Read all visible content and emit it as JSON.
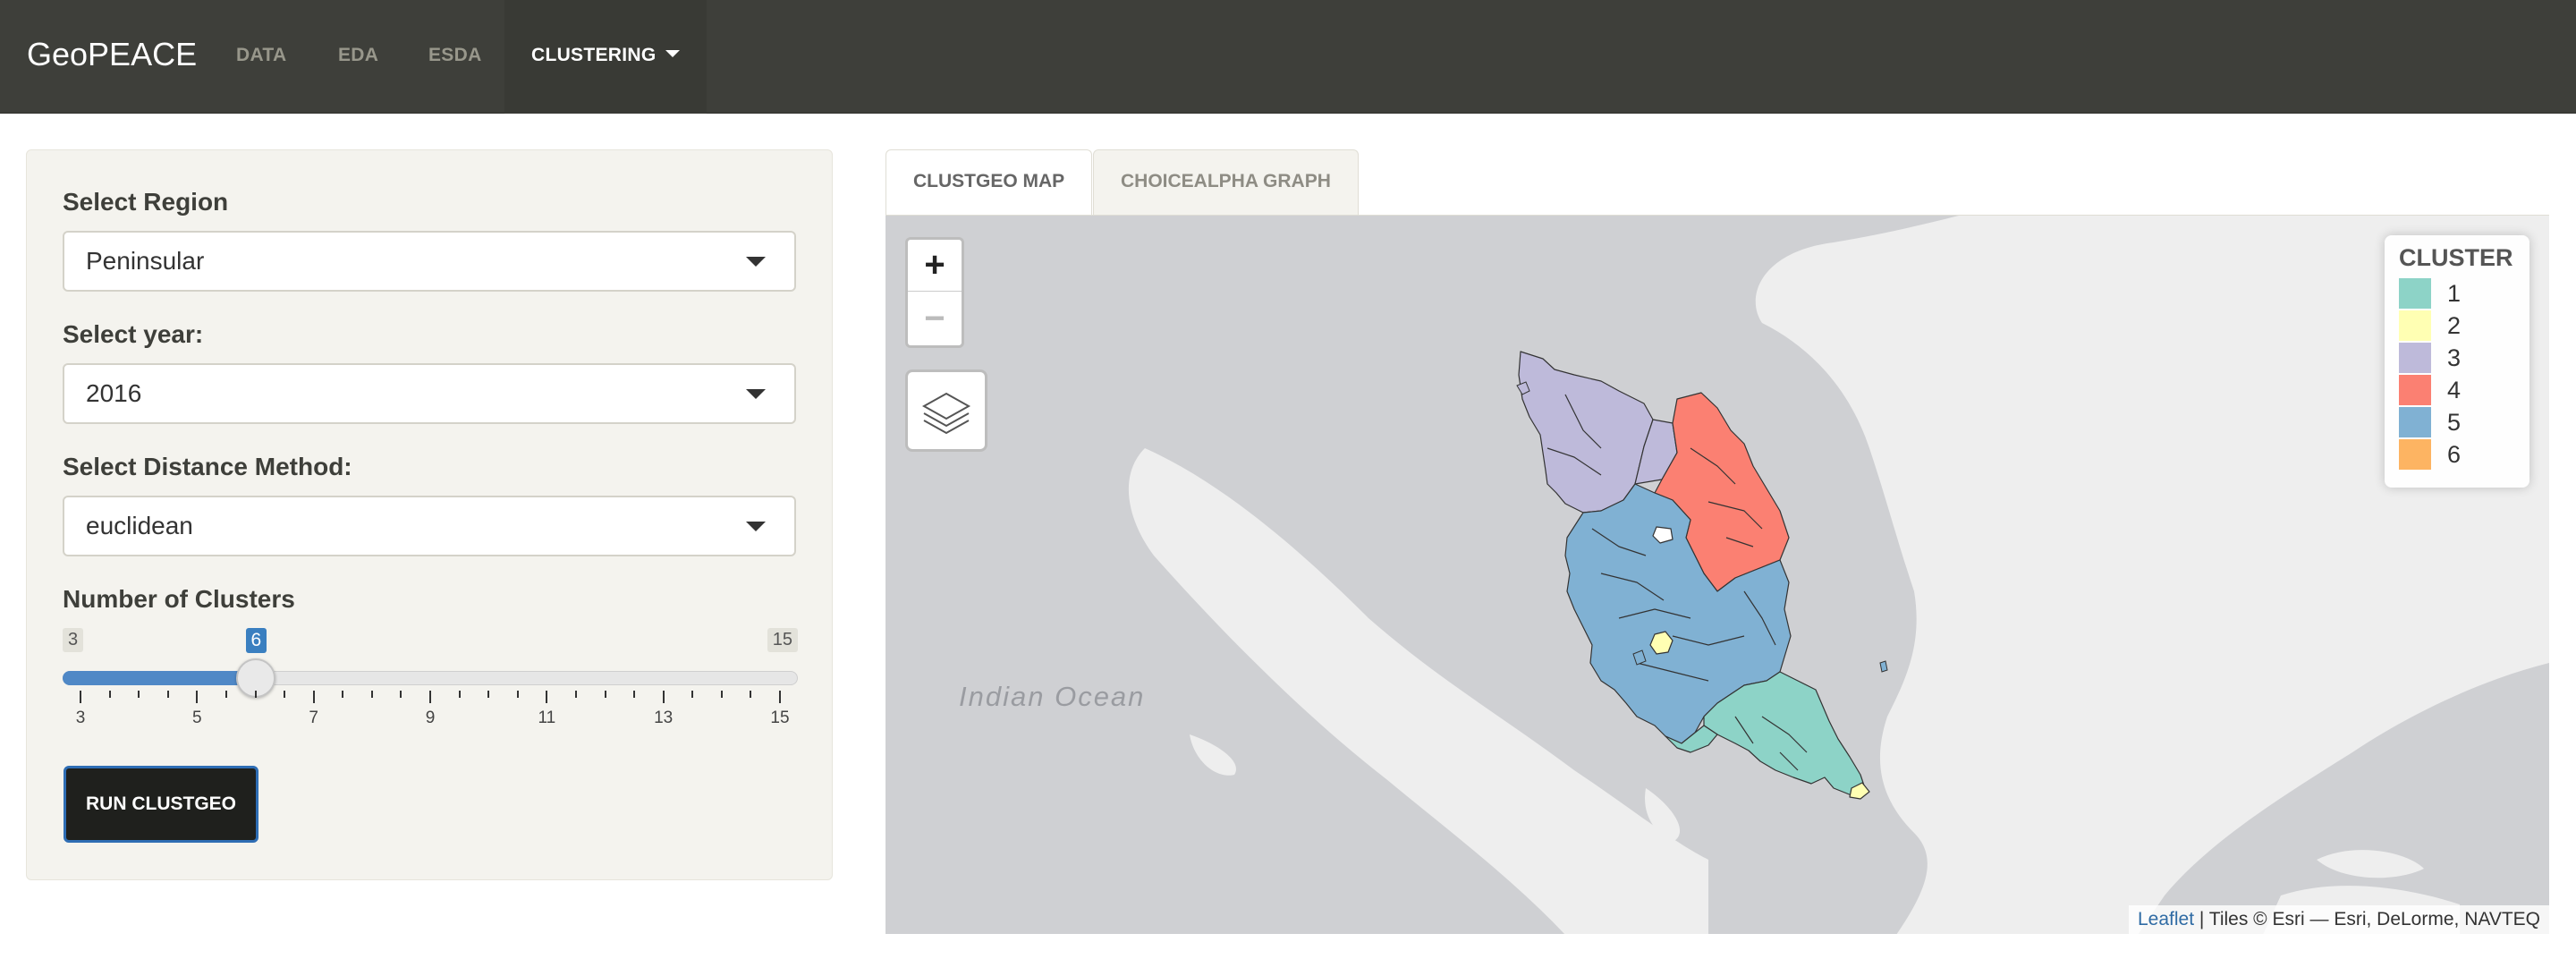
{
  "navbar": {
    "brand": "GeoPEACE",
    "items": [
      "DATA",
      "EDA",
      "ESDA"
    ],
    "active_item": "CLUSTERING"
  },
  "sidebar": {
    "region_label": "Select Region",
    "region_value": "Peninsular",
    "year_label": "Select year:",
    "year_value": "2016",
    "distance_label": "Select Distance Method:",
    "distance_value": "euclidean",
    "clusters_label": "Number of Clusters",
    "slider": {
      "min": 3,
      "max": 15,
      "value": 6,
      "tick_labels": [
        "3",
        "5",
        "7",
        "9",
        "11",
        "13",
        "15"
      ]
    },
    "run_button": "RUN CLUSTGEO"
  },
  "tabs": [
    {
      "label": "CLUSTGEO MAP",
      "active": true
    },
    {
      "label": "CHOICEALPHA GRAPH",
      "active": false
    }
  ],
  "map": {
    "zoom_in": "+",
    "zoom_out": "−",
    "layers_icon": "layers-icon",
    "ocean_label": "Indian Ocean",
    "legend_title": "CLUSTER",
    "legend": [
      {
        "label": "1",
        "color": "#8dd3c7"
      },
      {
        "label": "2",
        "color": "#ffffb3"
      },
      {
        "label": "3",
        "color": "#bebada"
      },
      {
        "label": "4",
        "color": "#fb8072"
      },
      {
        "label": "5",
        "color": "#80b1d3"
      },
      {
        "label": "6",
        "color": "#fdb462"
      }
    ],
    "attribution_link": "Leaflet",
    "attribution_text": " | Tiles © Esri — Esri, DeLorme, NAVTEQ"
  }
}
